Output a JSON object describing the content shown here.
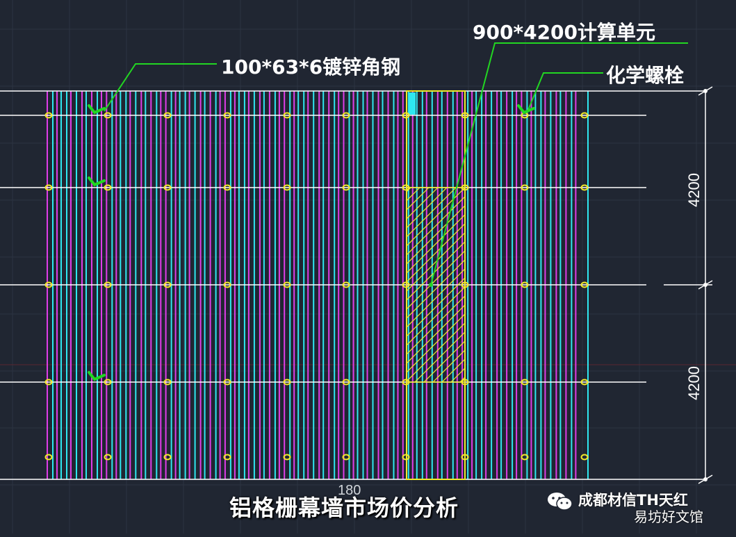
{
  "labels": {
    "steel": "100*63*6镀锌角钢",
    "unit": "900*4200计算单元",
    "bolt": "化学螺栓"
  },
  "dimensions": {
    "upper": "4200",
    "lower": "4200",
    "bottom": "180"
  },
  "caption": "铝格栅幕墙市场价分析",
  "watermark": {
    "line1": "成都材信TH天红",
    "line2": "易坊好文馆"
  },
  "colors": {
    "background": "#202632",
    "grid": "#2c3442",
    "magenta": "#e03ce8",
    "cyan": "#2ee8f0",
    "white": "#ffffff",
    "yellow": "#f2ea2a",
    "green": "#22d622"
  }
}
